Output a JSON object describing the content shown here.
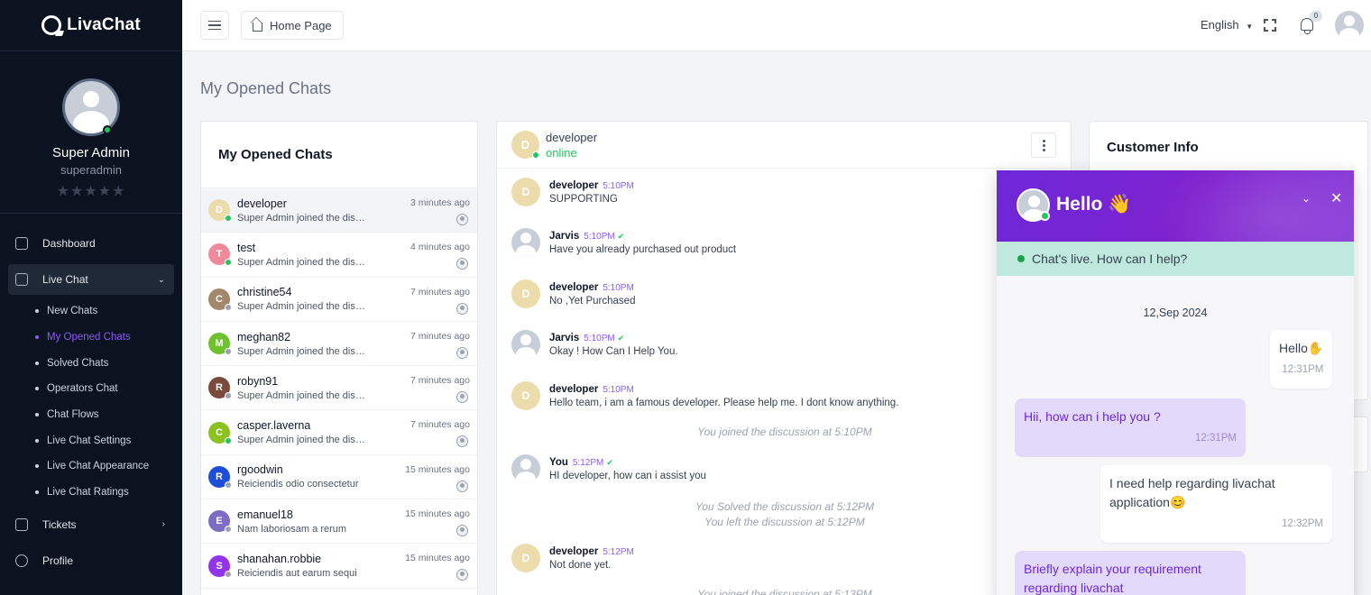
{
  "brand": {
    "name": "LivaChat"
  },
  "profile": {
    "name": "Super Admin",
    "role": "superadmin",
    "stars": "★★★★★"
  },
  "nav": {
    "dashboard": "Dashboard",
    "live_chat": "Live Chat",
    "sub_items": [
      "New Chats",
      "My Opened Chats",
      "Solved Chats",
      "Operators Chat",
      "Chat Flows",
      "Live Chat Settings",
      "Live Chat Appearance",
      "Live Chat Ratings"
    ],
    "tickets": "Tickets",
    "profile": "Profile"
  },
  "topbar": {
    "home": "Home Page",
    "language": "English",
    "notification_count": "0"
  },
  "page_title": "My Opened Chats",
  "chat_list": {
    "title": "My Opened Chats",
    "rows": [
      {
        "initial": "D",
        "name": "developer",
        "message": "Super Admin joined the discussion",
        "time": "3 minutes ago",
        "color": "#ecdcab",
        "status": "#22c55e"
      },
      {
        "initial": "T",
        "name": "test",
        "message": "Super Admin joined the discussion",
        "time": "4 minutes ago",
        "color": "#f08a9b",
        "status": "#22c55e"
      },
      {
        "initial": "C",
        "name": "christine54",
        "message": "Super Admin joined the discussion",
        "time": "7 minutes ago",
        "color": "#a3876a",
        "status": "#9ca3af"
      },
      {
        "initial": "M",
        "name": "meghan82",
        "message": "Super Admin joined the discussion",
        "time": "7 minutes ago",
        "color": "#6dc22e",
        "status": "#9ca3af"
      },
      {
        "initial": "R",
        "name": "robyn91",
        "message": "Super Admin joined the discussion",
        "time": "7 minutes ago",
        "color": "#7a4a3a",
        "status": "#9ca3af"
      },
      {
        "initial": "C",
        "name": "casper.laverna",
        "message": "Super Admin joined the discussion",
        "time": "7 minutes ago",
        "color": "#8cc21f",
        "status": "#22c55e"
      },
      {
        "initial": "R",
        "name": "rgoodwin",
        "message": "Reiciendis odio consectetur",
        "time": "15 minutes ago",
        "color": "#1d4ed8",
        "status": "#9ca3af"
      },
      {
        "initial": "E",
        "name": "emanuel18",
        "message": "Nam laboriosam a rerum",
        "time": "15 minutes ago",
        "color": "#7c6cc4",
        "status": "#9ca3af"
      },
      {
        "initial": "S",
        "name": "shanahan.robbie",
        "message": "Reiciendis aut earum sequi",
        "time": "15 minutes ago",
        "color": "#9333ea",
        "status": "#9ca3af"
      }
    ]
  },
  "conversation": {
    "name": "developer",
    "initial": "D",
    "status": "online",
    "messages": [
      {
        "author": "developer",
        "time": "5:10PM",
        "text": "SUPPORTING"
      },
      {
        "author": "Jarvis",
        "time": "5:10PM",
        "text": "Have you already purchased out product"
      },
      {
        "author": "developer",
        "time": "5:10PM",
        "text": "No ,Yet Purchased"
      },
      {
        "author": "Jarvis",
        "time": "5:10PM",
        "text": "Okay ! How Can I Help You."
      },
      {
        "author": "developer",
        "time": "5:10PM",
        "text": "Hello team, i am a famous developer. Please help me. I dont know anything."
      },
      {
        "author": "You",
        "time": "5:12PM",
        "text": "HI developer, how can i assist you"
      },
      {
        "author": "developer",
        "time": "5:12PM",
        "text": "Not done yet."
      }
    ],
    "system": {
      "joined1": "You joined the discussion at 5:10PM",
      "solved": "You Solved the discussion at 5:12PM",
      "left": "You left the discussion at 5:12PM",
      "joined2": "You joined the discussion at 5:13PM"
    }
  },
  "customer_info": {
    "title": "Customer Info"
  },
  "widget": {
    "title": "Hello 👋",
    "status": "Chat's live. How can I help?",
    "date": "12,Sep 2024",
    "bubbles": [
      {
        "text": "Hello✋",
        "time": "12:31PM"
      },
      {
        "text": "Hii, how can i help you ?",
        "time": "12:31PM"
      },
      {
        "text": "I need help regarding livachat application😊",
        "time": "12:32PM"
      },
      {
        "text": "Briefly explain your requirement regarding livachat"
      }
    ]
  }
}
